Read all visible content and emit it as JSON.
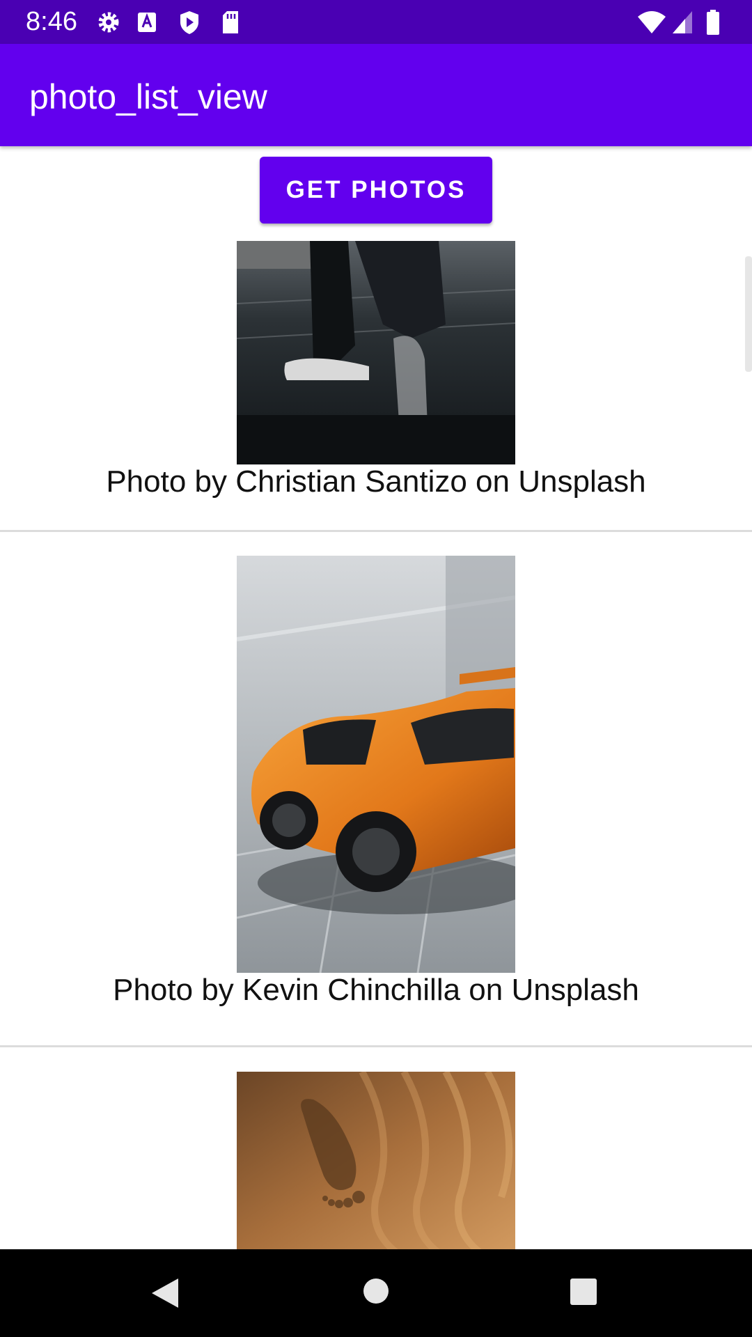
{
  "status_bar": {
    "time": "8:46",
    "left_icons": [
      "gear-icon",
      "a-box-icon",
      "shield-play-icon",
      "sd-card-icon"
    ],
    "right_icons": [
      "wifi-icon",
      "cell-signal-icon",
      "battery-icon"
    ]
  },
  "app_bar": {
    "title": "photo_list_view",
    "color": "#6200ee"
  },
  "main": {
    "button_label": "GET PHOTOS",
    "photos": [
      {
        "caption": "Photo by Christian Santizo on Unsplash",
        "image": "person-sneakers-dark-photo"
      },
      {
        "caption": "Photo by Kevin Chinchilla on Unsplash",
        "image": "orange-sports-car-photo"
      },
      {
        "caption": "",
        "image": "footprint-in-sand-photo"
      }
    ]
  },
  "nav_bar": {
    "buttons": [
      "back-icon",
      "home-icon",
      "recents-icon"
    ]
  }
}
